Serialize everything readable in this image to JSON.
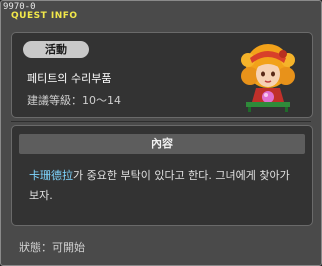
{
  "window": {
    "quest_id": "9970-0",
    "title": "QUEST INFO"
  },
  "summary": {
    "category_badge": "活動",
    "quest_name": "페티트의 수리부품",
    "level_label": "建議等級",
    "level_range": "10～14"
  },
  "content": {
    "header": "內容",
    "npc_name": "卡珊德拉",
    "description_rest": "가 중요한 부탁이 있다고 한다. 그녀에게 찾아가 보자."
  },
  "status": {
    "label": "狀態",
    "value": "可開始"
  },
  "npc_portrait": {
    "icon": "npc-cassandra-portrait",
    "hair_color": "#f2a21a",
    "headband_color": "#d8402a",
    "crystal_ball_color": "#e070d0"
  }
}
